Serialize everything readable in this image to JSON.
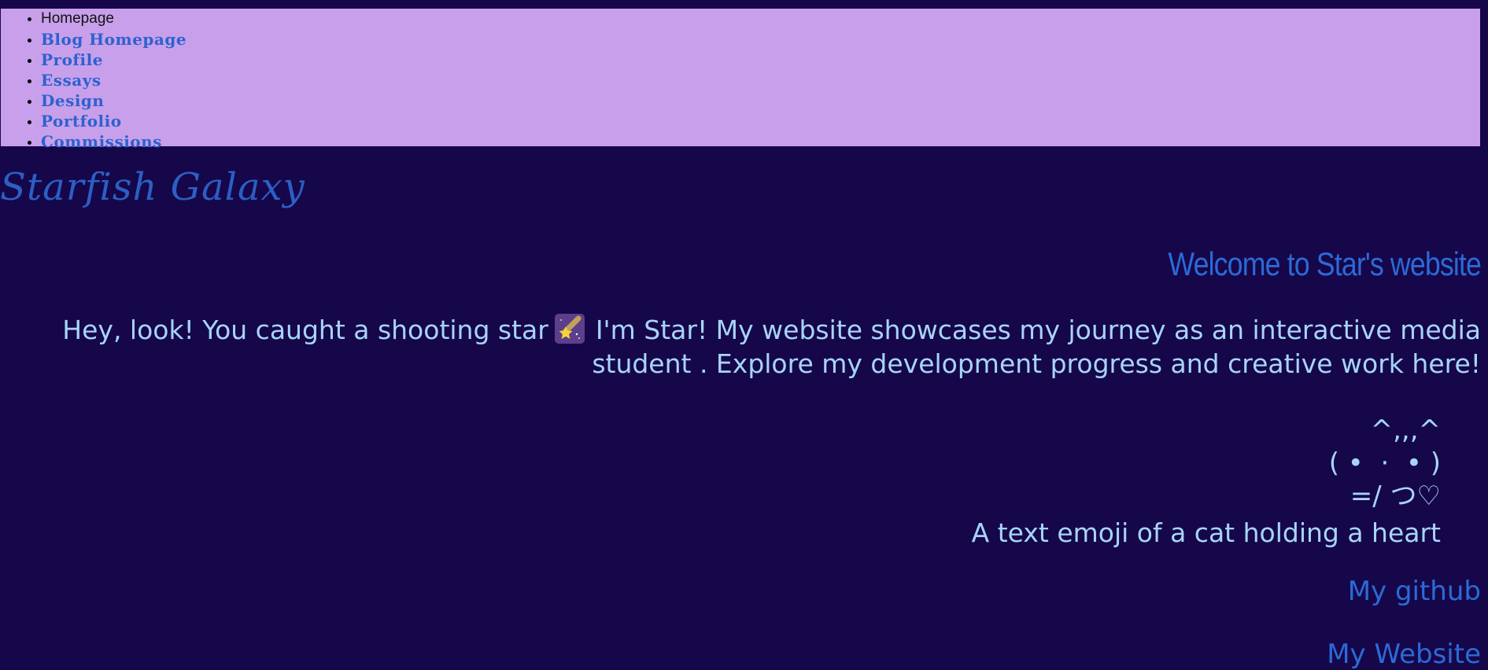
{
  "nav": {
    "items": [
      {
        "label": "Homepage",
        "current": true
      },
      {
        "label": "Blog Homepage"
      },
      {
        "label": "Profile"
      },
      {
        "label": "Essays"
      },
      {
        "label": "Design"
      },
      {
        "label": "Portfolio"
      },
      {
        "label": "Commissions"
      }
    ]
  },
  "header": {
    "site_title": "Starfish Galaxy"
  },
  "main": {
    "welcome": "Welcome to Star's website",
    "intro_part1": "Hey, look! You caught a shooting star",
    "intro_emoji": "shooting-star-icon",
    "intro_part2": "I'm Star! My website showcases my journey as an interactive media student . Explore my development progress and creative work here!",
    "cat": {
      "line1": "^,,,^",
      "line2": "( •  ·  • )",
      "line3": "=/ つ♡",
      "caption": "A text emoji of a cat holding a heart"
    },
    "links": {
      "github": "My github",
      "website": "My Website"
    }
  },
  "colors": {
    "background": "#16074a",
    "nav_background": "#c89fea",
    "link": "#2b6ad6",
    "text": "#a7d4f8"
  }
}
